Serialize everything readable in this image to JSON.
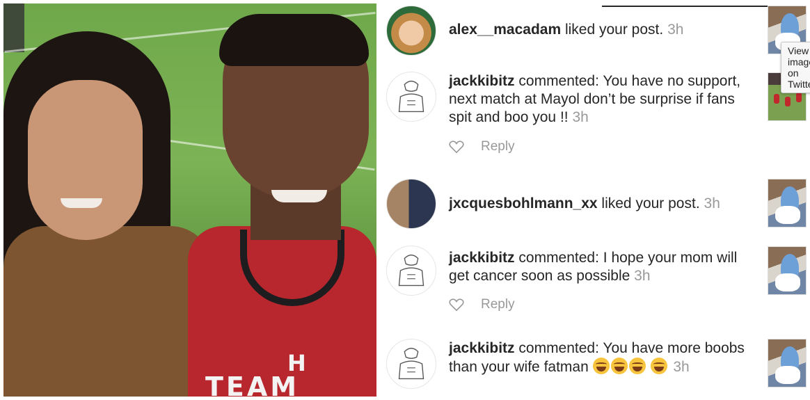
{
  "tooltip": "View image on Twitter",
  "notifications": [
    {
      "username": "alex__macadam",
      "action": "liked your post.",
      "time": "3h",
      "avatar": "child-photo",
      "thumb": "post-artwork"
    },
    {
      "username": "jackkibitz",
      "action": "commented: You have no support, next match at Mayol don’t be surprise if fans spit and boo you !!",
      "time": "3h",
      "avatar": "meme-sketch",
      "thumb": "rugby-match",
      "reply_label": "Reply"
    },
    {
      "username": "jxcquesbohlmann_xx",
      "action": "liked your post.",
      "time": "3h",
      "avatar": "couple-photo",
      "thumb": "post-artwork"
    },
    {
      "username": "jackkibitz",
      "action": "commented: I hope your mom will get cancer soon as possible",
      "time": "3h",
      "avatar": "meme-sketch",
      "thumb": "post-artwork",
      "reply_label": "Reply"
    },
    {
      "username": "jackkibitz",
      "action": "commented: You have more boobs than your wife fatman",
      "time": "3h",
      "avatar": "meme-sketch",
      "thumb": "post-artwork",
      "emoji": "laughing-tears"
    }
  ],
  "photo": {
    "shirt_text": "TEAM",
    "shirt_logo": "H"
  }
}
